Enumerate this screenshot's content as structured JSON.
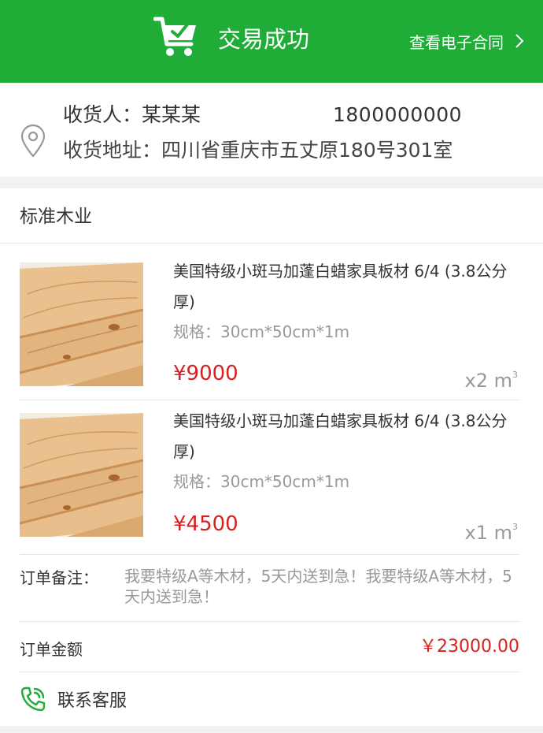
{
  "header": {
    "title": "交易成功",
    "contract_link": "查看电子合同",
    "cart_icon": "cart-check-icon",
    "chevron_icon": "chevron-right-icon",
    "brand_color": "#1fad38"
  },
  "address": {
    "recipient": "收货人：某某某",
    "phone": "1800000000",
    "address": "收货地址：四川省重庆市五丈原180号301室",
    "icon": "location-pin-icon"
  },
  "order": {
    "shop_name": "标准木业",
    "items": [
      {
        "name": "美国特级小斑马加蓬白蜡家具板材 6/4 (3.8公分厚)",
        "spec": "规格：30cm*50cm*1m",
        "price": "¥9000",
        "qty": "x2 m",
        "unit_sup": "3"
      },
      {
        "name": "美国特级小斑马加蓬白蜡家具板材 6/4 (3.8公分厚)",
        "spec": "规格：30cm*50cm*1m",
        "price": "¥4500",
        "qty": "x1 m",
        "unit_sup": "3"
      }
    ],
    "remark_label": "订单备注：",
    "remark_text": "我要特级A等木材，5天内送到急！我要特级A等木材，5天内送到急！",
    "amount_label": "订单金额",
    "amount_value": "￥23000.00",
    "price_color": "#d8201f"
  },
  "service": {
    "label": "联系客服",
    "icon": "phone-call-icon"
  }
}
